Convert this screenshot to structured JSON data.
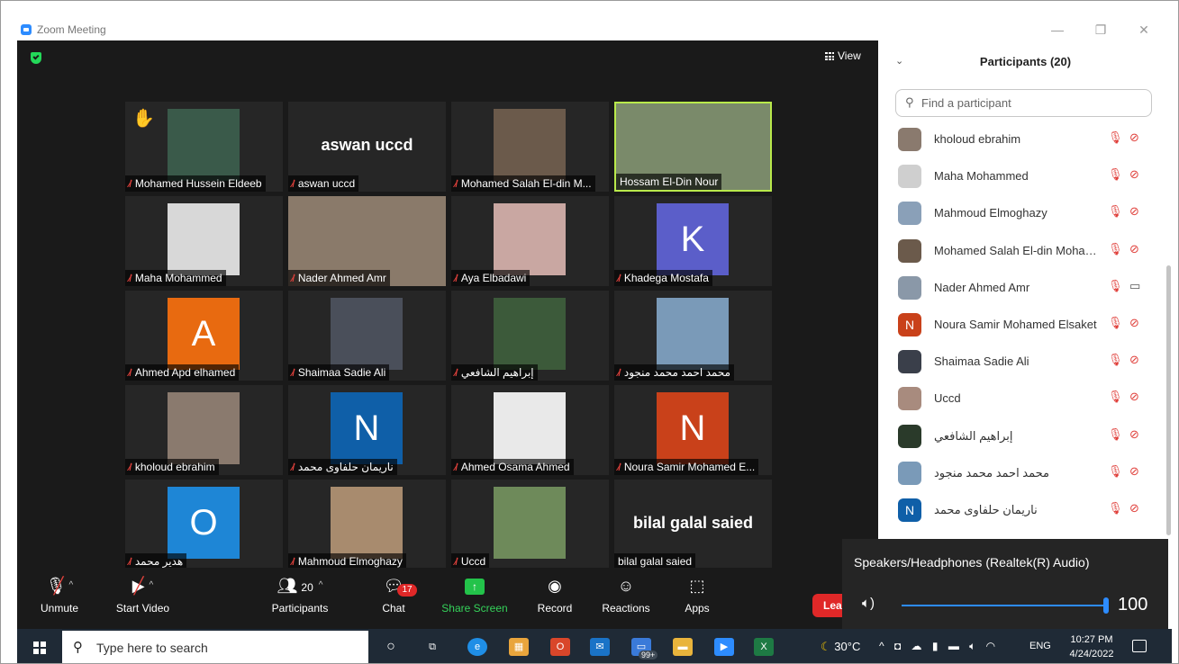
{
  "window": {
    "title": "Zoom Meeting"
  },
  "video": {
    "view_label": "View",
    "tiles": [
      {
        "name": "Mohamed Hussein Eldeeb",
        "type": "photo",
        "color": "#3a5a4a",
        "hand": true
      },
      {
        "name": "aswan uccd",
        "type": "text",
        "big": "aswan uccd"
      },
      {
        "name": "Mohamed Salah El-din M...",
        "type": "photo",
        "color": "#6b5a4b"
      },
      {
        "name": "Hossam El-Din Nour",
        "type": "photo",
        "color": "#7a8a6a",
        "active": true,
        "video": true
      },
      {
        "name": "Maha Mohammed",
        "type": "photo",
        "color": "#d8d8d8"
      },
      {
        "name": "Nader Ahmed Amr",
        "type": "photo",
        "color": "#8a7a6a",
        "video": true
      },
      {
        "name": "Aya Elbadawi",
        "type": "photo",
        "color": "#c9a7a2"
      },
      {
        "name": "Khadega Mostafa",
        "type": "letter",
        "letter": "K",
        "color": "#5b5ec9"
      },
      {
        "name": "Ahmed Apd elhamed",
        "type": "letter",
        "letter": "A",
        "color": "#e86a10"
      },
      {
        "name": "Shaimaa Sadie Ali",
        "type": "photo",
        "color": "#4a4f5a"
      },
      {
        "name": "إبراهيم الشافعي",
        "type": "photo",
        "color": "#3c5a3a"
      },
      {
        "name": "محمد احمد محمد منجود",
        "type": "photo",
        "color": "#7a9ab8"
      },
      {
        "name": "kholoud ebrahim",
        "type": "photo",
        "color": "#8a7a6e"
      },
      {
        "name": "ناريمان حلفاوى محمد",
        "type": "letter",
        "letter": "N",
        "color": "#0f5fa8"
      },
      {
        "name": "Ahmed Osama Ahmed",
        "type": "photo",
        "color": "#e9e9e9"
      },
      {
        "name": "Noura Samir Mohamed E...",
        "type": "letter",
        "letter": "N",
        "color": "#c9411a"
      },
      {
        "name": "هدير محمد",
        "type": "letter",
        "letter": "O",
        "color": "#1e86d6"
      },
      {
        "name": "Mahmoud Elmoghazy",
        "type": "photo",
        "color": "#a88b6e"
      },
      {
        "name": "Uccd",
        "type": "photo",
        "color": "#6e8a5a"
      },
      {
        "name": "bilal galal saied",
        "type": "text",
        "big": "bilal galal saied",
        "nomic": true
      }
    ]
  },
  "toolbar": {
    "unmute": "Unmute",
    "start_video": "Start Video",
    "participants": "Participants",
    "participants_count": "20",
    "chat": "Chat",
    "chat_badge": "17",
    "share_screen": "Share Screen",
    "record": "Record",
    "reactions": "Reactions",
    "apps": "Apps",
    "leave": "Lea"
  },
  "panel": {
    "title": "Participants (20)",
    "search_placeholder": "Find a participant",
    "participants": [
      {
        "name": "kholoud ebrahim",
        "type": "photo",
        "color": "#8a7a6e"
      },
      {
        "name": "Maha Mohammed",
        "type": "photo",
        "color": "#cfcfcf"
      },
      {
        "name": "Mahmoud Elmoghazy",
        "type": "photo",
        "color": "#8aa0b8"
      },
      {
        "name": "Mohamed Salah El-din Moham...",
        "type": "photo",
        "color": "#6b5a4b"
      },
      {
        "name": "Nader Ahmed Amr",
        "type": "photo",
        "color": "#8a98a8",
        "video_on": true
      },
      {
        "name": "Noura Samir Mohamed Elsaket",
        "type": "letter",
        "letter": "N",
        "color": "#c9411a"
      },
      {
        "name": "Shaimaa Sadie Ali",
        "type": "photo",
        "color": "#3a3f4a"
      },
      {
        "name": "Uccd",
        "type": "photo",
        "color": "#a88b7e"
      },
      {
        "name": "إبراهيم الشافعي",
        "type": "photo",
        "color": "#2a3a2a"
      },
      {
        "name": "محمد احمد محمد منجود",
        "type": "photo",
        "color": "#7a9ab8"
      },
      {
        "name": "ناريمان حلفاوى محمد",
        "type": "letter",
        "letter": "N",
        "color": "#0f5fa8"
      }
    ]
  },
  "speaker_popup": {
    "device": "Speakers/Headphones (Realtek(R) Audio)",
    "volume": "100",
    "level": 1.0
  },
  "taskbar": {
    "search_placeholder": "Type here to search",
    "weather": "30°C",
    "language": "ENG",
    "time": "10:27 PM",
    "date": "4/24/2022",
    "badge": "99+"
  }
}
